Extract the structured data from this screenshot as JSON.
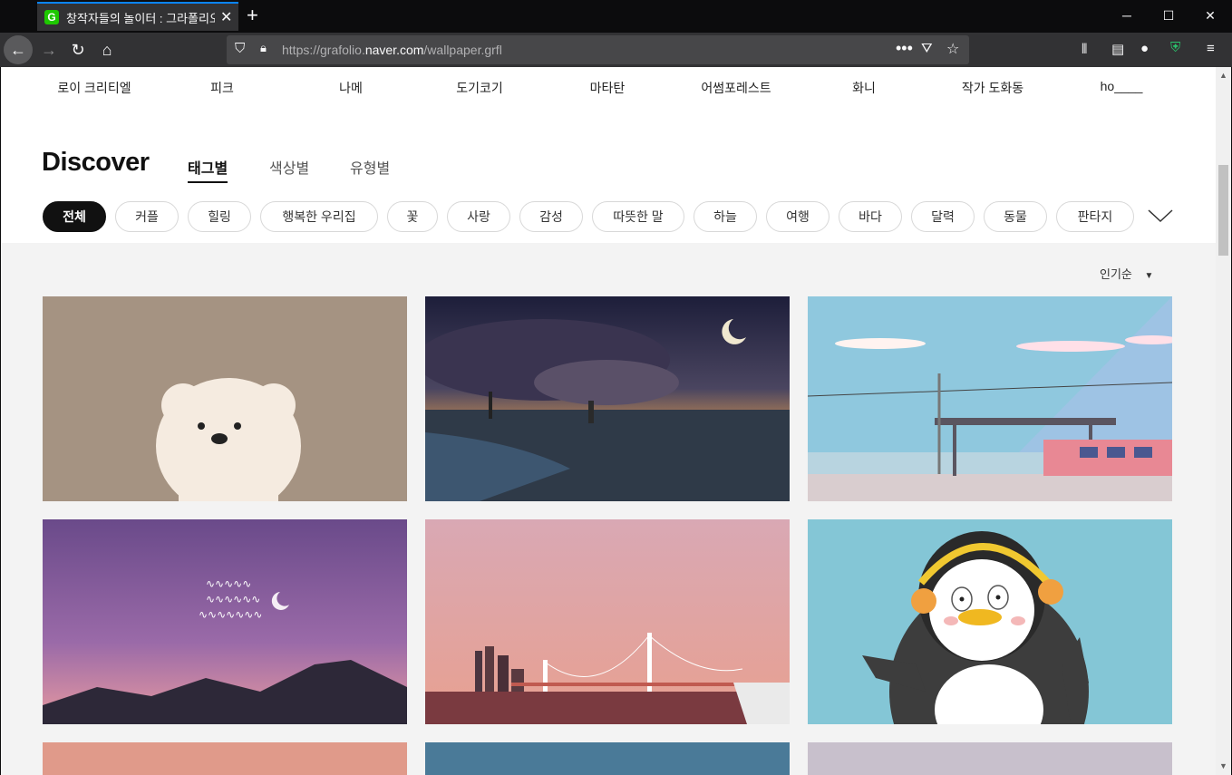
{
  "browser": {
    "tab_title": "창작자들의 놀이터 : 그라폴리오",
    "favicon_letter": "G",
    "url_prefix": "https://grafolio.",
    "url_domain": "naver.com",
    "url_path": "/wallpaper.grfl"
  },
  "artists": [
    "로이 크리티엘",
    "피크",
    "나메",
    "도기코기",
    "마타탄",
    "어썸포레스트",
    "화니",
    "작가 도화동",
    "ho____"
  ],
  "discover": {
    "title": "Discover",
    "tabs": [
      "태그별",
      "색상별",
      "유형별"
    ],
    "active_tab": "태그별"
  },
  "tags": [
    "전체",
    "커플",
    "힐링",
    "행복한 우리집",
    "꽃",
    "사랑",
    "감성",
    "따뜻한 말",
    "하늘",
    "여행",
    "바다",
    "달력",
    "동물",
    "판타지"
  ],
  "sort": {
    "label": "인기순"
  },
  "wallpapers": [
    {
      "name": "polar-bear",
      "bg": "#a59382"
    },
    {
      "name": "night-city-moon",
      "bg": "#3b3a55"
    },
    {
      "name": "train-station-sea",
      "bg": "#8ec4dc"
    },
    {
      "name": "purple-mountain-sky",
      "bg": "#8a5c9e"
    },
    {
      "name": "bridge-pink-sky",
      "bg": "#d8a4ac"
    },
    {
      "name": "penguin-headphones",
      "bg": "#84c6d6"
    }
  ]
}
